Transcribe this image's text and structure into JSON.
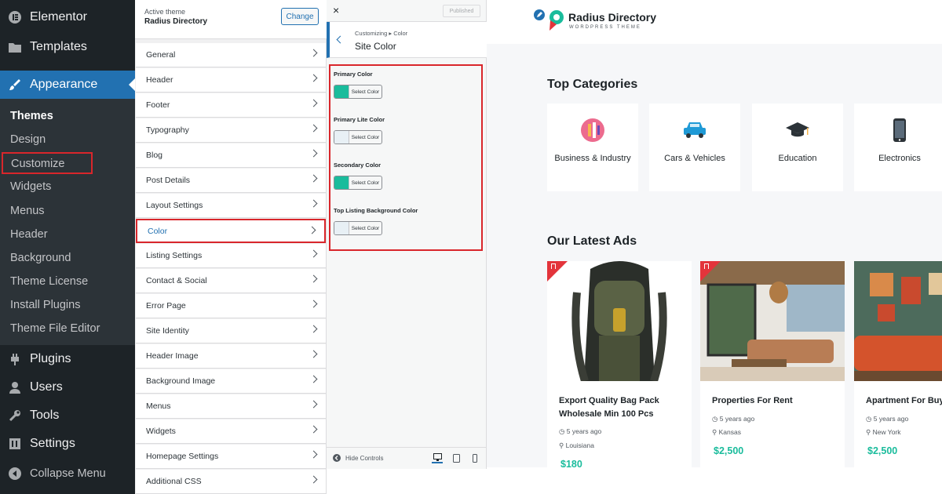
{
  "admin_menu": {
    "elementor": "Elementor",
    "templates": "Templates",
    "appearance": "Appearance",
    "sub": [
      "Themes",
      "Design",
      "Customize",
      "Widgets",
      "Menus",
      "Header",
      "Background",
      "Theme License",
      "Install Plugins",
      "Theme File Editor"
    ],
    "plugins": "Plugins",
    "users": "Users",
    "tools": "Tools",
    "settings": "Settings",
    "collapse": "Collapse Menu"
  },
  "customizer": {
    "active_theme_label": "Active theme",
    "theme_name": "Radius Directory",
    "change_label": "Change",
    "sections": [
      "General",
      "Header",
      "Footer",
      "Typography",
      "Blog",
      "Post Details",
      "Layout Settings",
      "Color",
      "Listing Settings",
      "Contact & Social",
      "Error Page",
      "Site Identity",
      "Header Image",
      "Background Image",
      "Menus",
      "Widgets",
      "Homepage Settings",
      "Additional CSS"
    ]
  },
  "color_panel": {
    "close": "×",
    "published": "Published",
    "breadcrumb": "Customizing ▸ Color",
    "title": "Site Color",
    "controls": [
      {
        "label": "Primary Color",
        "button": "Select Color",
        "swatch": "#1abc9c"
      },
      {
        "label": "Primary Lite Color",
        "button": "Select Color",
        "swatch": "#e8f0f5"
      },
      {
        "label": "Secondary Color",
        "button": "Select Color",
        "swatch": "#1abc9c"
      },
      {
        "label": "Top Listing Background Color",
        "button": "Select Color",
        "swatch": "#e8f0f5"
      }
    ],
    "hide_controls": "Hide Controls"
  },
  "preview": {
    "logo_title": "Radius Directory",
    "logo_sub": "WORDPRESS THEME",
    "categories_heading": "Top Categories",
    "categories": [
      "Business & Industry",
      "Cars & Vehicles",
      "Education",
      "Electronics"
    ],
    "ads_heading": "Our Latest Ads",
    "ads": [
      {
        "title": "Export Quality Bag Pack Wholesale Min 100 Pcs",
        "time": "5 years ago",
        "location": "Louisiana",
        "price": "$180"
      },
      {
        "title": "Properties For Rent",
        "time": "5 years ago",
        "location": "Kansas",
        "price": "$2,500"
      },
      {
        "title": "Apartment For Buy",
        "time": "5 years ago",
        "location": "New York",
        "price": "$2,500"
      }
    ]
  },
  "colors": {
    "accent": "#2271b1",
    "highlight": "#d9262b",
    "brand": "#1abc9c"
  }
}
